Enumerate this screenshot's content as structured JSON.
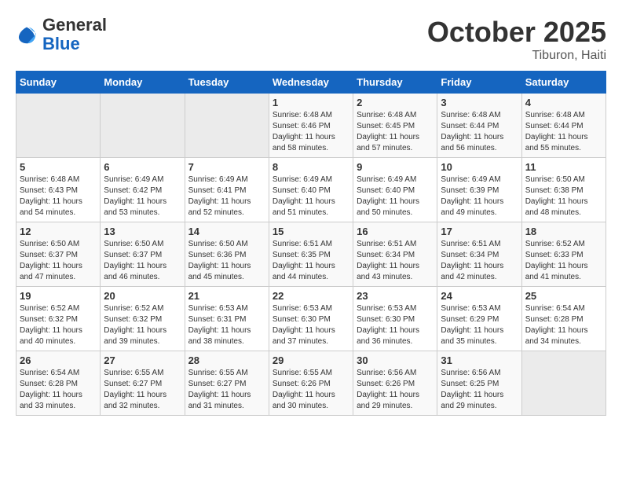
{
  "header": {
    "logo_general": "General",
    "logo_blue": "Blue",
    "month": "October 2025",
    "location": "Tiburon, Haiti"
  },
  "days_of_week": [
    "Sunday",
    "Monday",
    "Tuesday",
    "Wednesday",
    "Thursday",
    "Friday",
    "Saturday"
  ],
  "weeks": [
    [
      {
        "day": "",
        "info": ""
      },
      {
        "day": "",
        "info": ""
      },
      {
        "day": "",
        "info": ""
      },
      {
        "day": "1",
        "info": "Sunrise: 6:48 AM\nSunset: 6:46 PM\nDaylight: 11 hours and 58 minutes."
      },
      {
        "day": "2",
        "info": "Sunrise: 6:48 AM\nSunset: 6:45 PM\nDaylight: 11 hours and 57 minutes."
      },
      {
        "day": "3",
        "info": "Sunrise: 6:48 AM\nSunset: 6:44 PM\nDaylight: 11 hours and 56 minutes."
      },
      {
        "day": "4",
        "info": "Sunrise: 6:48 AM\nSunset: 6:44 PM\nDaylight: 11 hours and 55 minutes."
      }
    ],
    [
      {
        "day": "5",
        "info": "Sunrise: 6:48 AM\nSunset: 6:43 PM\nDaylight: 11 hours and 54 minutes."
      },
      {
        "day": "6",
        "info": "Sunrise: 6:49 AM\nSunset: 6:42 PM\nDaylight: 11 hours and 53 minutes."
      },
      {
        "day": "7",
        "info": "Sunrise: 6:49 AM\nSunset: 6:41 PM\nDaylight: 11 hours and 52 minutes."
      },
      {
        "day": "8",
        "info": "Sunrise: 6:49 AM\nSunset: 6:40 PM\nDaylight: 11 hours and 51 minutes."
      },
      {
        "day": "9",
        "info": "Sunrise: 6:49 AM\nSunset: 6:40 PM\nDaylight: 11 hours and 50 minutes."
      },
      {
        "day": "10",
        "info": "Sunrise: 6:49 AM\nSunset: 6:39 PM\nDaylight: 11 hours and 49 minutes."
      },
      {
        "day": "11",
        "info": "Sunrise: 6:50 AM\nSunset: 6:38 PM\nDaylight: 11 hours and 48 minutes."
      }
    ],
    [
      {
        "day": "12",
        "info": "Sunrise: 6:50 AM\nSunset: 6:37 PM\nDaylight: 11 hours and 47 minutes."
      },
      {
        "day": "13",
        "info": "Sunrise: 6:50 AM\nSunset: 6:37 PM\nDaylight: 11 hours and 46 minutes."
      },
      {
        "day": "14",
        "info": "Sunrise: 6:50 AM\nSunset: 6:36 PM\nDaylight: 11 hours and 45 minutes."
      },
      {
        "day": "15",
        "info": "Sunrise: 6:51 AM\nSunset: 6:35 PM\nDaylight: 11 hours and 44 minutes."
      },
      {
        "day": "16",
        "info": "Sunrise: 6:51 AM\nSunset: 6:34 PM\nDaylight: 11 hours and 43 minutes."
      },
      {
        "day": "17",
        "info": "Sunrise: 6:51 AM\nSunset: 6:34 PM\nDaylight: 11 hours and 42 minutes."
      },
      {
        "day": "18",
        "info": "Sunrise: 6:52 AM\nSunset: 6:33 PM\nDaylight: 11 hours and 41 minutes."
      }
    ],
    [
      {
        "day": "19",
        "info": "Sunrise: 6:52 AM\nSunset: 6:32 PM\nDaylight: 11 hours and 40 minutes."
      },
      {
        "day": "20",
        "info": "Sunrise: 6:52 AM\nSunset: 6:32 PM\nDaylight: 11 hours and 39 minutes."
      },
      {
        "day": "21",
        "info": "Sunrise: 6:53 AM\nSunset: 6:31 PM\nDaylight: 11 hours and 38 minutes."
      },
      {
        "day": "22",
        "info": "Sunrise: 6:53 AM\nSunset: 6:30 PM\nDaylight: 11 hours and 37 minutes."
      },
      {
        "day": "23",
        "info": "Sunrise: 6:53 AM\nSunset: 6:30 PM\nDaylight: 11 hours and 36 minutes."
      },
      {
        "day": "24",
        "info": "Sunrise: 6:53 AM\nSunset: 6:29 PM\nDaylight: 11 hours and 35 minutes."
      },
      {
        "day": "25",
        "info": "Sunrise: 6:54 AM\nSunset: 6:28 PM\nDaylight: 11 hours and 34 minutes."
      }
    ],
    [
      {
        "day": "26",
        "info": "Sunrise: 6:54 AM\nSunset: 6:28 PM\nDaylight: 11 hours and 33 minutes."
      },
      {
        "day": "27",
        "info": "Sunrise: 6:55 AM\nSunset: 6:27 PM\nDaylight: 11 hours and 32 minutes."
      },
      {
        "day": "28",
        "info": "Sunrise: 6:55 AM\nSunset: 6:27 PM\nDaylight: 11 hours and 31 minutes."
      },
      {
        "day": "29",
        "info": "Sunrise: 6:55 AM\nSunset: 6:26 PM\nDaylight: 11 hours and 30 minutes."
      },
      {
        "day": "30",
        "info": "Sunrise: 6:56 AM\nSunset: 6:26 PM\nDaylight: 11 hours and 29 minutes."
      },
      {
        "day": "31",
        "info": "Sunrise: 6:56 AM\nSunset: 6:25 PM\nDaylight: 11 hours and 29 minutes."
      },
      {
        "day": "",
        "info": ""
      }
    ]
  ]
}
